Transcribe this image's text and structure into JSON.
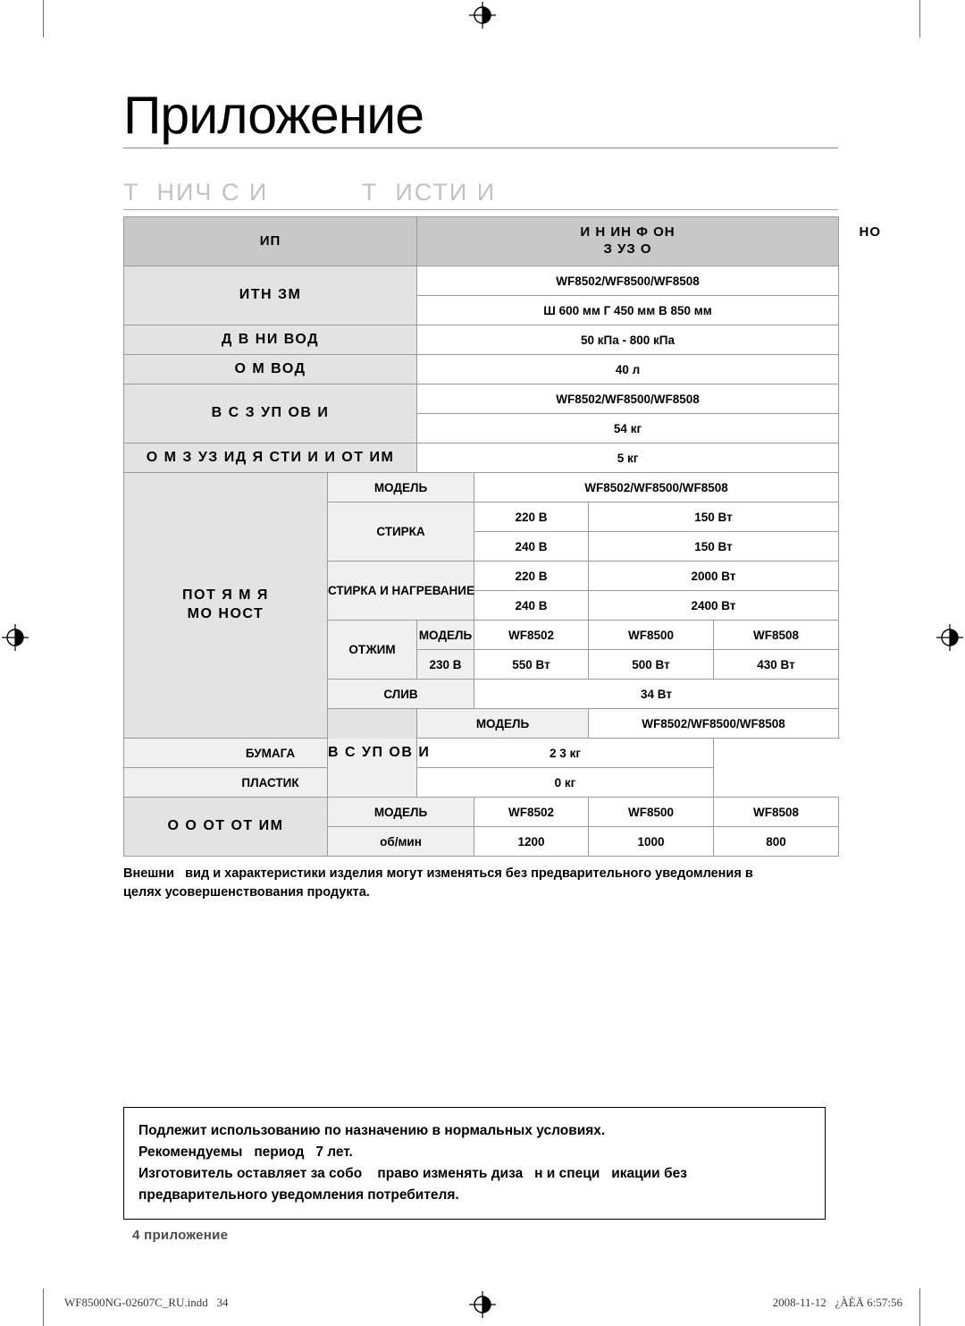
{
  "document": {
    "chapter_title": "Приложение",
    "section_heading": "Т  НИЧ С И           Т  ИСТИ И"
  },
  "table": {
    "header": {
      "left": "ИП",
      "right_line1": "И       Н          ИН     Ф  ОН",
      "right_line2": "З     УЗ  О",
      "right_overflow": "НО"
    },
    "rows": [
      {
        "label": "ИТН         ЗМ",
        "values": [
          "WF8502/WF8500/WF8508",
          "Ш 600 мм     Г 450 мм     В 850 мм"
        ]
      },
      {
        "label": "Д  В    НИ  ВОД",
        "values": [
          "50 кПа - 800 кПа"
        ]
      },
      {
        "label": "О        М ВОД",
        "values": [
          "40 л"
        ]
      },
      {
        "label": "В  С      З УП    ОВ  И",
        "values": [
          "WF8502/WF8500/WF8508",
          "54 кг"
        ]
      },
      {
        "label": "О      М З      УЗ  ИД  Я СТИ    И И ОТ  ИМ",
        "values": [
          "5   кг"
        ]
      }
    ],
    "power_section": {
      "label_line1": "ПОТ          Я  М  Я",
      "label_line2": "МО  НОСТ",
      "model_label": "МОДЕЛЬ",
      "model_value": "WF8502/WF8500/WF8508",
      "wash_label": "СТИРКА",
      "wash_rows": [
        {
          "voltage": "220 В",
          "power": "150 Вт"
        },
        {
          "voltage": "240 В",
          "power": "150 Вт"
        }
      ],
      "wash_heat_label": "СТИРКА И НАГРЕВАНИЕ",
      "wash_heat_rows": [
        {
          "voltage": "220 В",
          "power": "2000 Вт"
        },
        {
          "voltage": "240 В",
          "power": "2400 Вт"
        }
      ],
      "spin_label": "ОТЖИМ",
      "spin_model_label": "МОДЕЛЬ",
      "spin_models": [
        "WF8502",
        "WF8500",
        "WF8508"
      ],
      "spin_voltage": "230 В",
      "spin_powers": [
        "550 Вт",
        "500 Вт",
        "430 Вт"
      ],
      "drain_label": "СЛИВ",
      "drain_value": "34 Вт"
    },
    "packaging_section": {
      "label": "В  С УП    ОВ  И",
      "model_label": "МОДЕЛЬ",
      "model_value": "WF8502/WF8500/WF8508",
      "paper_label": "БУМАГА",
      "paper_value": "2  3 кг",
      "plastic_label": "ПЛАСТИК",
      "plastic_value": "0   кг"
    },
    "spin_speed_section": {
      "label": "О  О   ОТ    ОТ  ИМ",
      "model_label": "МОДЕЛЬ",
      "models": [
        "WF8502",
        "WF8500",
        "WF8508"
      ],
      "unit_label": "об/мин",
      "speeds": [
        "1200",
        "1000",
        "800"
      ]
    }
  },
  "table_note": "Внешни   вид и характеристики изделия могут изменяться без предварительного уведомления в\nцелях усовершенствования продукта.",
  "warranty_box": "Подлежит использованию по назначению в нормальных условиях.\nРекомендуемы   период   7 лет.\nИзготовитель оставляет за собо    право изменять диза   н и специ   икации без\nпредварительного уведомления потребителя.",
  "page_footer": "4 приложение",
  "print_footer": {
    "left": "WF8500NG-02607C_RU.indd   34",
    "right": "2008-11-12   ¿ÀÈÄ 6:57:56"
  },
  "colors": {
    "header_gray": "#c8c8c8",
    "label_gray": "#e3e3e3",
    "sublabel_gray": "#f0f0f0",
    "ghost_text": "#bdbdbd",
    "border": "#9a9a9a"
  }
}
